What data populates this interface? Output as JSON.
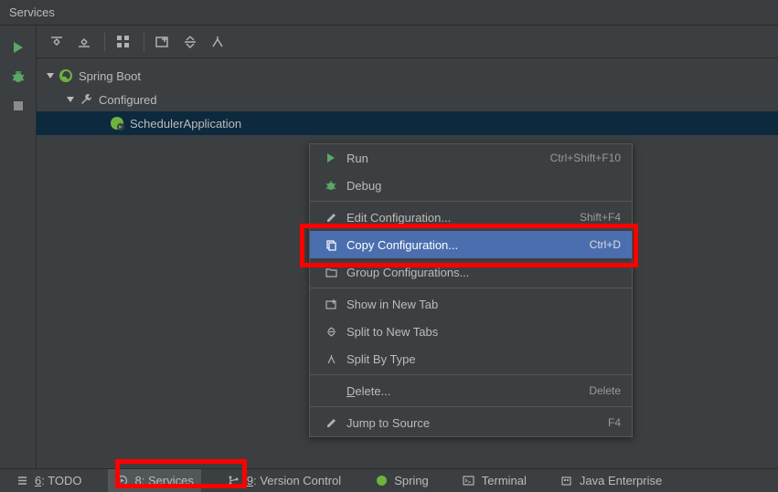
{
  "header": {
    "title": "Services"
  },
  "gutter": {
    "run": "Run",
    "debug": "Debug",
    "stop": "Stop"
  },
  "tree": {
    "root": {
      "label": "Spring Boot"
    },
    "configured": {
      "label": "Configured"
    },
    "app": {
      "label": "SchedulerApplication"
    }
  },
  "menu": {
    "run": {
      "label": "Run",
      "shortcut": "Ctrl+Shift+F10"
    },
    "debug": {
      "label": "Debug"
    },
    "edit": {
      "label": "Edit Configuration...",
      "shortcut": "Shift+F4"
    },
    "copy": {
      "label": "Copy Configuration...",
      "shortcut": "Ctrl+D"
    },
    "group": {
      "label": "Group Configurations..."
    },
    "newtab": {
      "label": "Show in New Tab"
    },
    "split": {
      "label": "Split to New Tabs"
    },
    "splittype": {
      "label": "Split By Type"
    },
    "delete": {
      "label_pre": "",
      "label_u": "D",
      "label_post": "elete...",
      "shortcut": "Delete"
    },
    "jump": {
      "label": "Jump to Source",
      "shortcut": "F4"
    }
  },
  "bottom": {
    "todo": {
      "pre": "",
      "u": "6",
      "post": ": TODO"
    },
    "services": {
      "pre": "",
      "u": "8",
      "post": ": Services"
    },
    "vcs": {
      "pre": "",
      "u": "9",
      "post": ": Version Control"
    },
    "spring": {
      "label": "Spring"
    },
    "terminal": {
      "label": "Terminal"
    },
    "enterprise": {
      "label": "Java Enterprise"
    }
  },
  "colors": {
    "run": "#59a869",
    "debug": "#59a869",
    "spring": "#6db33f"
  }
}
